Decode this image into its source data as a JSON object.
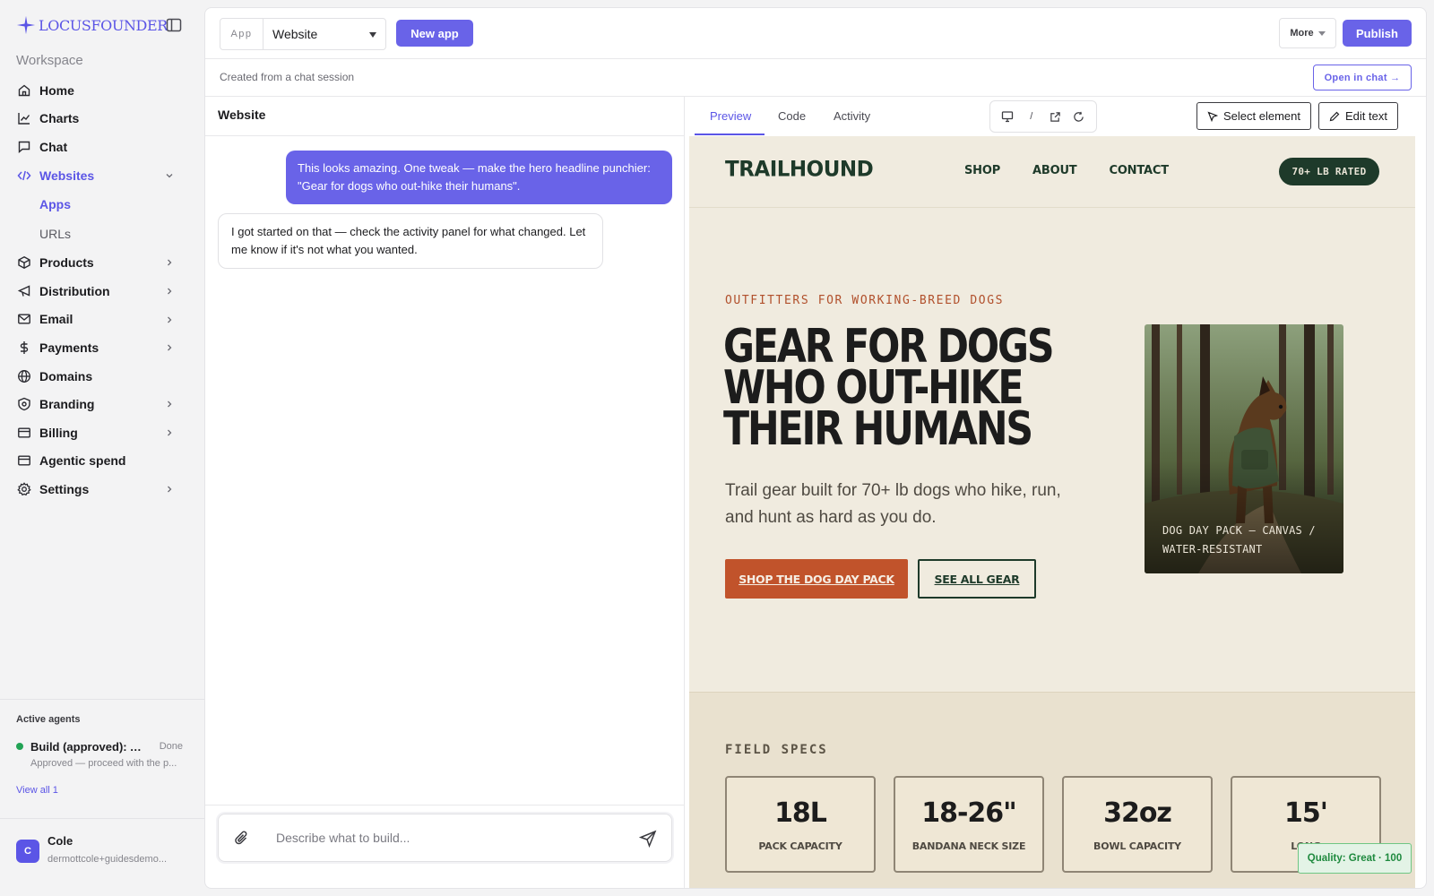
{
  "brand": {
    "name_part1": "LOCUS",
    "name_part2": "FOUNDER",
    "accent": "#5b55e6"
  },
  "sidebar": {
    "workspace_label": "Workspace",
    "items": [
      {
        "label": "Home",
        "icon": "home-icon"
      },
      {
        "label": "Charts",
        "icon": "chart-icon"
      },
      {
        "label": "Chat",
        "icon": "chat-icon"
      },
      {
        "label": "Websites",
        "icon": "code-icon",
        "expanded": true
      },
      {
        "label": "Products",
        "icon": "box-icon"
      },
      {
        "label": "Distribution",
        "icon": "megaphone-icon"
      },
      {
        "label": "Email",
        "icon": "mail-icon"
      },
      {
        "label": "Payments",
        "icon": "dollar-icon"
      },
      {
        "label": "Domains",
        "icon": "globe-icon"
      },
      {
        "label": "Branding",
        "icon": "badge-icon"
      },
      {
        "label": "Billing",
        "icon": "card-icon"
      },
      {
        "label": "Agentic spend",
        "icon": "card-icon"
      },
      {
        "label": "Settings",
        "icon": "gear-icon"
      }
    ],
    "sub_items": [
      "Apps",
      "URLs"
    ]
  },
  "agents": {
    "title": "Active agents",
    "items": [
      {
        "name": "Build (approved): A...",
        "status": "Done",
        "description": "Approved — proceed with the p..."
      }
    ],
    "view_all": "View all 1"
  },
  "user": {
    "initial": "C",
    "name": "Cole",
    "email": "dermottcole+guidesdemo..."
  },
  "topbar": {
    "app_label": "App",
    "app_value": "Website",
    "new_app": "New app",
    "more": "More",
    "publish": "Publish"
  },
  "subbar": {
    "text": "Created from a chat session",
    "open_chat": "Open in chat →"
  },
  "chat": {
    "title": "Website",
    "messages": [
      {
        "role": "user",
        "text": "This looks amazing. One tweak — make the hero headline punchier: \"Gear for dogs who out-hike their humans\"."
      },
      {
        "role": "assistant",
        "text": "I got started on that — check the activity panel for what changed. Let me know if it's not what you wanted."
      }
    ],
    "composer_placeholder": "Describe what to build..."
  },
  "preview": {
    "tabs": [
      "Preview",
      "Code",
      "Activity"
    ],
    "active_tab": "Preview",
    "device_sep": "/",
    "select_element": "Select element",
    "edit_text": "Edit text"
  },
  "site": {
    "brand": "TRAILHOUND",
    "nav": [
      "SHOP",
      "ABOUT",
      "CONTACT"
    ],
    "badge": "70+ LB RATED",
    "eyebrow": "OUTFITTERS FOR WORKING-BREED DOGS",
    "headline": "GEAR FOR DOGS WHO OUT-HIKE THEIR HUMANS",
    "lede": "Trail gear built for 70+ lb dogs who hike, run, and hunt as hard as you do.",
    "cta_primary": "SHOP THE DOG DAY PACK",
    "cta_secondary": "SEE ALL GEAR",
    "image_caption": "DOG DAY PACK — CANVAS / WATER-RESISTANT",
    "specs_title": "FIELD SPECS",
    "specs": [
      {
        "value": "18L",
        "label": "PACK CAPACITY"
      },
      {
        "value": "18-26\"",
        "label": "BANDANA NECK SIZE"
      },
      {
        "value": "32oz",
        "label": "BOWL CAPACITY"
      },
      {
        "value": "15'",
        "label": "LONG"
      }
    ],
    "colors": {
      "forest": "#1e3a2a",
      "rust": "#c1532b",
      "sand": "#f0ebdf"
    }
  },
  "quality_badge": "Quality: Great · 100"
}
